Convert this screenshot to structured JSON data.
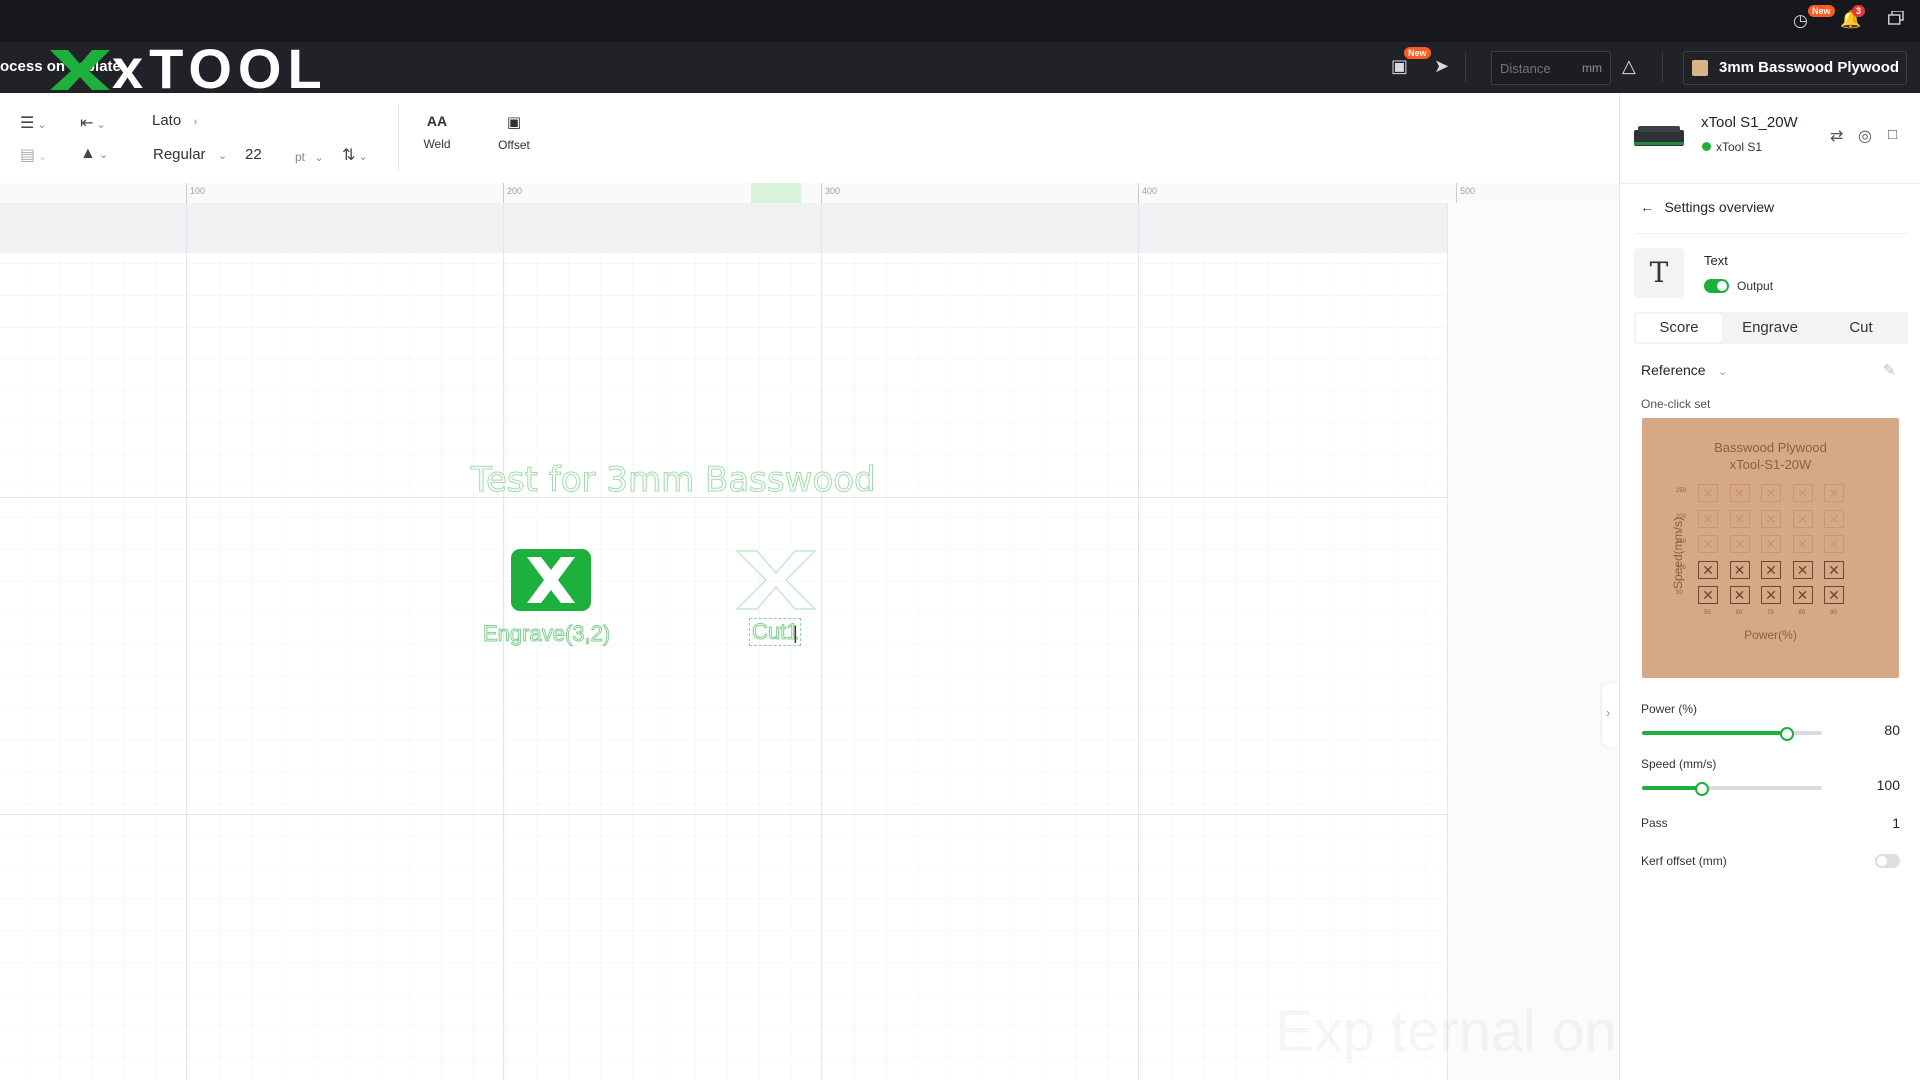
{
  "topbar": {
    "new_badge": "New",
    "notification_count": "3"
  },
  "header": {
    "project_title": "ocess on ceplate",
    "logo_text": "xTOOL",
    "capture_badge": "New",
    "distance_placeholder": "Distance",
    "distance_unit": "mm",
    "material": "3mm Basswood Plywood",
    "material_color": "#d9b48a"
  },
  "toolbar": {
    "font_family": "Lato",
    "font_style": "Regular",
    "font_size": "22",
    "font_unit": "pt",
    "weld_label": "Weld",
    "offset_label": "Offset"
  },
  "ruler": {
    "ticks": [
      "100",
      "200",
      "300",
      "400",
      "500"
    ]
  },
  "canvas": {
    "title_text": "Test for 3mm Basswood",
    "engrave_label": "Engrave(3,2)",
    "cut_label": "Cut1",
    "accent": "#1db03d",
    "watermark": "Exp   ternal    only"
  },
  "device": {
    "name": "xTool S1_20W",
    "model": "xTool S1",
    "status_color": "#1db03d"
  },
  "panel": {
    "back_label": "Settings overview",
    "object_type": "Text",
    "output_label": "Output",
    "tabs": [
      "Score",
      "Engrave",
      "Cut"
    ],
    "active_tab": "Score",
    "reference_label": "Reference",
    "one_click_label": "One-click set",
    "preset_image": {
      "title_line1": "Basswood Plywood",
      "title_line2": "xTool-S1-20W",
      "y_axis": "Speed(mm/s)",
      "x_axis": "Power(%)",
      "y_ticks": [
        "250",
        "200",
        "150",
        "100",
        "50"
      ],
      "x_ticks": [
        "50",
        "60",
        "70",
        "80",
        "90"
      ]
    },
    "power_label": "Power (%)",
    "power_value": "80",
    "power_fraction": 0.8,
    "speed_label": "Speed (mm/s)",
    "speed_value": "100",
    "speed_fraction": 0.33,
    "pass_label": "Pass",
    "pass_value": "1",
    "kerf_label": "Kerf offset (mm)"
  }
}
